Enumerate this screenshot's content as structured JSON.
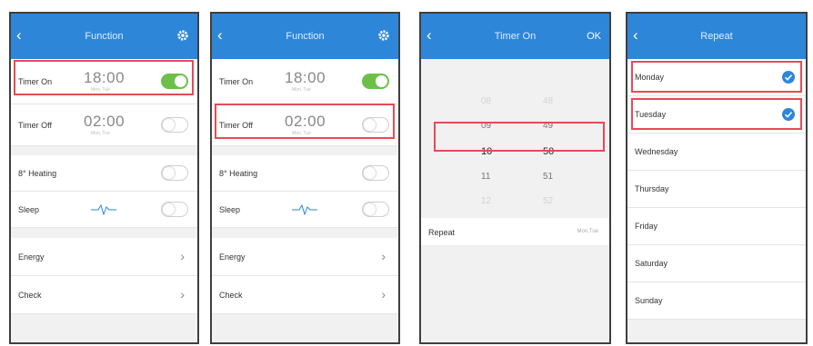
{
  "screens": [
    {
      "title": "Function",
      "rows": [
        {
          "label": "Timer On",
          "time": "18:00",
          "time_sub": "Mon, Tue"
        },
        {
          "label": "Timer Off",
          "time": "02:00",
          "time_sub": "Mon, Tue"
        },
        {
          "label": "8° Heating"
        },
        {
          "label": "Sleep"
        },
        {
          "label": "Energy"
        },
        {
          "label": "Check"
        }
      ],
      "toggles": {
        "timer_on": "on",
        "timer_off": "off",
        "heating": "off",
        "sleep": "off"
      },
      "highlighted_row": "Timer On"
    },
    {
      "title": "Function",
      "rows": [
        {
          "label": "Timer On",
          "time": "18:00",
          "time_sub": "Mon, Tue"
        },
        {
          "label": "Timer Off",
          "time": "02:00",
          "time_sub": "Mon, Tue"
        },
        {
          "label": "8° Heating"
        },
        {
          "label": "Sleep"
        },
        {
          "label": "Energy"
        },
        {
          "label": "Check"
        }
      ],
      "toggles": {
        "timer_on": "on",
        "timer_off": "off",
        "heating": "off",
        "sleep": "off"
      },
      "highlighted_row": "Timer Off"
    },
    {
      "title": "Timer On",
      "ok_label": "OK",
      "picker": {
        "hours": [
          "08",
          "09",
          "10",
          "11",
          "12"
        ],
        "minutes": [
          "48",
          "49",
          "50",
          "51",
          "52"
        ],
        "selected_hour": "10",
        "selected_minute": "50"
      },
      "repeat_label": "Repeat",
      "repeat_value": "Mon,Tue"
    },
    {
      "title": "Repeat",
      "days": [
        {
          "label": "Monday",
          "checked": true
        },
        {
          "label": "Tuesday",
          "checked": true
        },
        {
          "label": "Wednesday",
          "checked": false
        },
        {
          "label": "Thursday",
          "checked": false
        },
        {
          "label": "Friday",
          "checked": false
        },
        {
          "label": "Saturday",
          "checked": false
        },
        {
          "label": "Sunday",
          "checked": false
        }
      ]
    }
  ],
  "colors": {
    "header": "#2e86d8",
    "toggle_on": "#6cc04a",
    "highlight": "#e84a55",
    "check": "#2e86d8"
  }
}
